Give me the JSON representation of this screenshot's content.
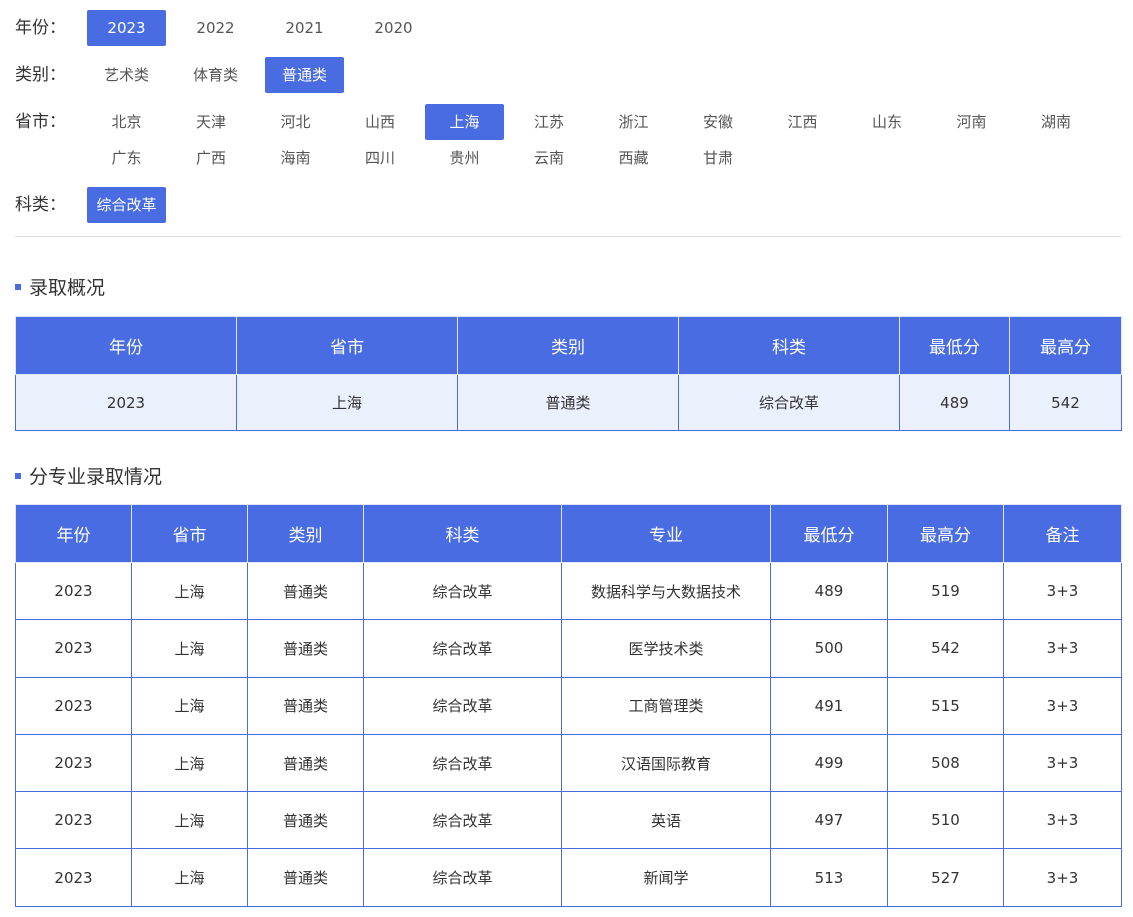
{
  "filters": {
    "year": {
      "label": "年份：",
      "options": [
        "2023",
        "2022",
        "2021",
        "2020"
      ],
      "selected": "2023"
    },
    "category": {
      "label": "类别：",
      "options": [
        "艺术类",
        "体育类",
        "普通类"
      ],
      "selected": "普通类"
    },
    "province": {
      "label": "省市：",
      "options": [
        "北京",
        "天津",
        "河北",
        "山西",
        "上海",
        "江苏",
        "浙江",
        "安徽",
        "江西",
        "山东",
        "河南",
        "湖南",
        "广东",
        "广西",
        "海南",
        "四川",
        "贵州",
        "云南",
        "西藏",
        "甘肃"
      ],
      "selected": "上海"
    },
    "subject": {
      "label": "科类：",
      "options": [
        "综合改革"
      ],
      "selected": "综合改革"
    }
  },
  "summary": {
    "title": "录取概况",
    "headers": [
      "年份",
      "省市",
      "类别",
      "科类",
      "最低分",
      "最高分"
    ],
    "rows": [
      [
        "2023",
        "上海",
        "普通类",
        "综合改革",
        "489",
        "542"
      ]
    ]
  },
  "majors": {
    "title": "分专业录取情况",
    "headers": [
      "年份",
      "省市",
      "类别",
      "科类",
      "专业",
      "最低分",
      "最高分",
      "备注"
    ],
    "rows": [
      [
        "2023",
        "上海",
        "普通类",
        "综合改革",
        "数据科学与大数据技术",
        "489",
        "519",
        "3+3"
      ],
      [
        "2023",
        "上海",
        "普通类",
        "综合改革",
        "医学技术类",
        "500",
        "542",
        "3+3"
      ],
      [
        "2023",
        "上海",
        "普通类",
        "综合改革",
        "工商管理类",
        "491",
        "515",
        "3+3"
      ],
      [
        "2023",
        "上海",
        "普通类",
        "综合改革",
        "汉语国际教育",
        "499",
        "508",
        "3+3"
      ],
      [
        "2023",
        "上海",
        "普通类",
        "综合改革",
        "英语",
        "497",
        "510",
        "3+3"
      ],
      [
        "2023",
        "上海",
        "普通类",
        "综合改革",
        "新闻学",
        "513",
        "527",
        "3+3"
      ]
    ]
  },
  "colors": {
    "accent": "#4a6ce2",
    "summary_row_bg": "#ebf0fd"
  }
}
